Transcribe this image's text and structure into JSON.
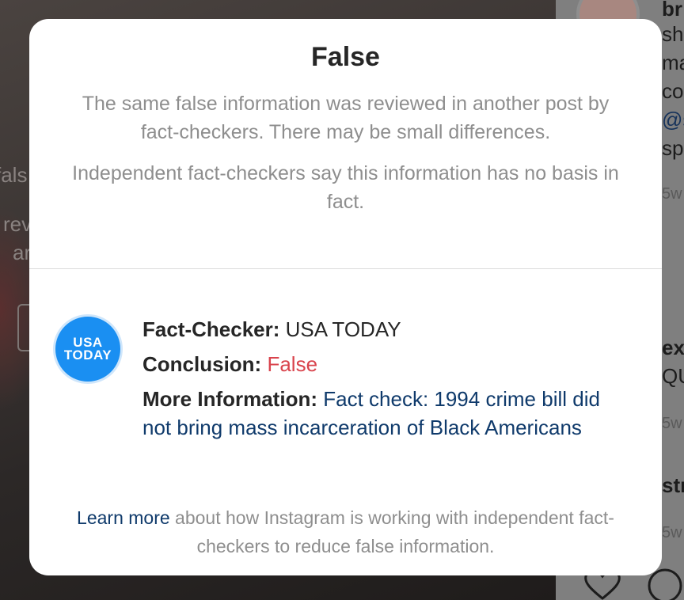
{
  "background": {
    "left_fragments": [
      "fals",
      "rev",
      "ar"
    ],
    "right_fragments": {
      "username_fragment": "br",
      "caption_lines": [
        "sh",
        "ma",
        "co"
      ],
      "mention_fragment": "@s",
      "caption_tail": "sp",
      "time_1": "5w",
      "comment_user_fragment": "ex",
      "comment_text_fragment": "QU",
      "time_2": "5w",
      "comment_user_fragment_2": "str",
      "time_3": "5w"
    },
    "icons": [
      "heart-icon",
      "comment-icon"
    ]
  },
  "modal": {
    "title": "False",
    "description": "The same false information was reviewed in another post by fact-checkers. There may be small differences.",
    "verdict_text": "Independent fact-checkers say this information has no basis in fact.",
    "fact_checker": {
      "logo_line_1": "USA",
      "logo_line_2": "TODAY",
      "fact_checker_label": "Fact-Checker:",
      "fact_checker_value": "USA TODAY",
      "conclusion_label": "Conclusion:",
      "conclusion_value": "False",
      "more_info_label": "More Information:",
      "more_info_link": "Fact check: 1994 crime bill did not bring mass incarceration of Black Americans"
    },
    "footer": {
      "learn_more_link": "Learn more",
      "text": " about how Instagram is working with independent fact-checkers to reduce false information."
    }
  },
  "colors": {
    "false_red": "#d9444d",
    "link_blue": "#0f3a6b",
    "logo_blue": "#1a8ff2",
    "muted_text": "#8e8e8e"
  }
}
